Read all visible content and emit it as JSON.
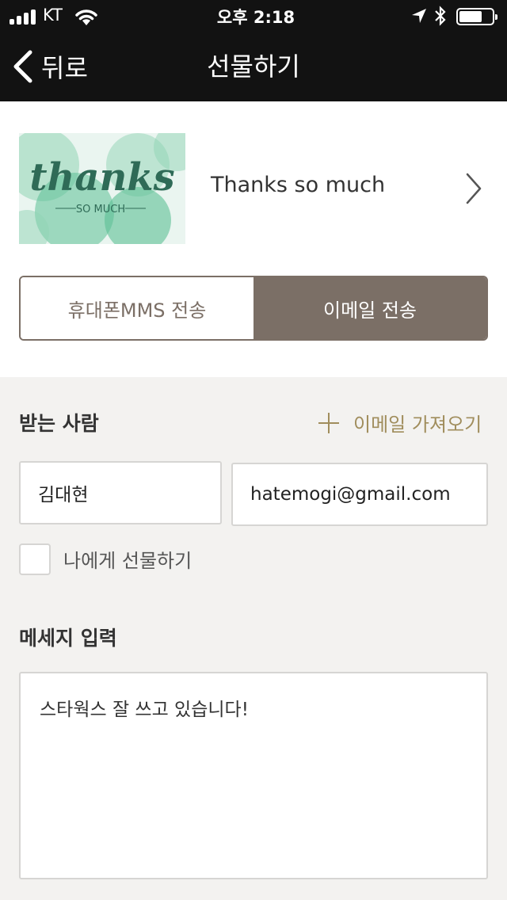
{
  "status_bar": {
    "carrier": "KT",
    "time": "오후 2:18"
  },
  "nav": {
    "back_label": "뒤로",
    "title": "선물하기"
  },
  "card": {
    "thumbnail_title": "thanks",
    "thumbnail_subtitle": "SO MUCH",
    "name": "Thanks so much"
  },
  "send_type": {
    "options": [
      "휴대폰MMS 전송",
      "이메일 전송"
    ],
    "selected": "이메일 전송"
  },
  "recipient": {
    "label": "받는 사람",
    "import_label": "이메일 가져오기",
    "name_value": "김대현",
    "email_value": "hatemogi@gmail.com",
    "self_gift_label": "나에게 선물하기",
    "self_gift_checked": false
  },
  "message": {
    "label": "메세지 입력",
    "value": "스타웍스 잘 쓰고 있습니다!"
  },
  "colors": {
    "nav_bg": "#121212",
    "segment_active": "#7b6f66",
    "accent_gold": "#a08d5c",
    "card_green": "#5bbf95"
  }
}
